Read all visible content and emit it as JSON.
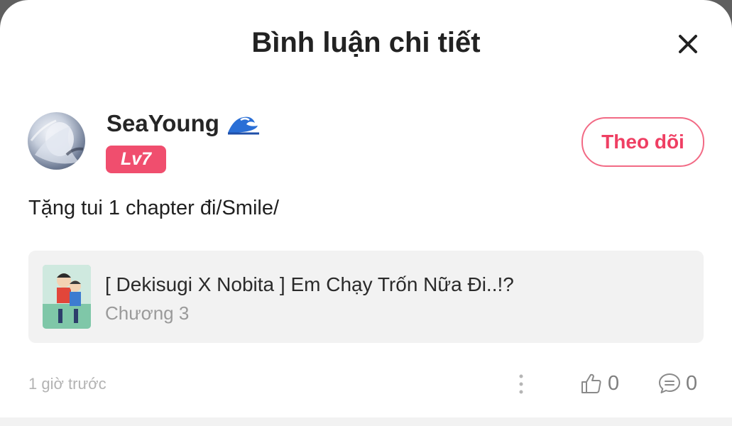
{
  "header": {
    "title": "Bình luận chi tiết",
    "close_icon": "close-icon"
  },
  "comment": {
    "author": {
      "name": "SeaYoung",
      "emoji_icon": "wave-icon",
      "level": "Lv7"
    },
    "follow_label": "Theo dõi",
    "text": "Tặng tui 1 chapter đi/Smile/",
    "timestamp": "1 giờ trước",
    "likes": "0",
    "replies": "0"
  },
  "story": {
    "title": "[ Dekisugi X Nobita ] Em Chạy Trốn Nữa Đi..!?",
    "chapter": "Chương 3"
  },
  "colors": {
    "accent": "#ef3f63",
    "badge": "#f04e6e",
    "card_bg": "#f2f2f2",
    "muted": "#9a9a9a"
  }
}
